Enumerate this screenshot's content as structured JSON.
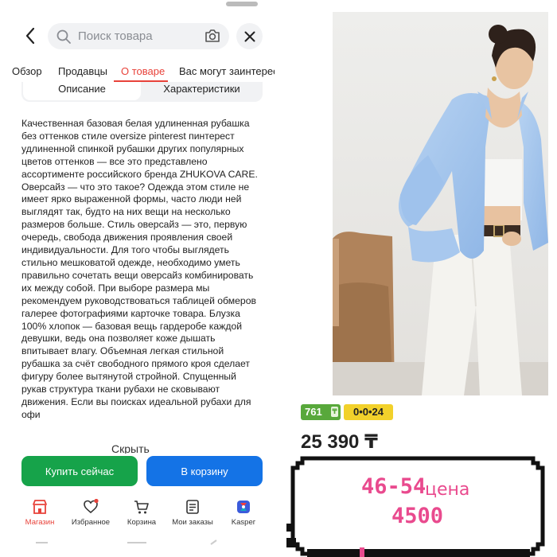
{
  "search": {
    "placeholder": "Поиск товара"
  },
  "tabs": [
    {
      "label": "Обзор"
    },
    {
      "label": "Продавцы"
    },
    {
      "label": "О товаре"
    },
    {
      "label": "Вас могут заинтерес"
    }
  ],
  "active_tab_index": 2,
  "segments": [
    {
      "label": "Описание"
    },
    {
      "label": "Характеристики"
    }
  ],
  "description": "Качественная базовая белая удлиненная рубашка\nбез оттенков стиле oversize pinterest пинтерест\nудлиненной спинкой рубашки других популярных\nцветов оттенков — все это представлено\nассортименте российского бренда ZHUKOVA CARE.\nОверсайз — что это такое? Одежда этом стиле не\nимеет ярко выраженной формы, часто люди ней\nвыглядят так, будто на них вещи на несколько\nразмеров больше. Стиль оверсайз — это, первую\nочередь, свобода движения проявления своей\nиндивидуальности. Для того чтобы выглядеть\nстильно мешковатой одежде, необходимо уметь\nправильно сочетать вещи оверсайз комбинировать\nих между собой. При выборе размера мы\nрекомендуем руководствоваться таблицей обмеров\nгалерее фотографиями карточке товара. Блузка\n100% хлопок — базовая вещь гардеробе каждой\nдевушки, ведь она позволяет коже дышать\nвпитывает влагу. Объемная легкая стильной\nрубашка за счёт свободного прямого кроя сделает\nфигуру более вытянутой стройной. Спущенный\nрукав структура ткани рубахи не сковывают\nдвижения. Если вы поисках идеальной рубахи для\nофи",
  "collapse_label": "Скрыть",
  "buttons": {
    "buy": "Купить сейчас",
    "cart": "В корзину"
  },
  "bottom_nav": [
    {
      "label": "Магазин",
      "icon": "shop-icon"
    },
    {
      "label": "Избранное",
      "icon": "heart-icon"
    },
    {
      "label": "Корзина",
      "icon": "cart-icon"
    },
    {
      "label": "Мои заказы",
      "icon": "orders-icon"
    },
    {
      "label": "Kaspeг",
      "icon": "kaspi-icon"
    }
  ],
  "active_nav_index": 0,
  "product": {
    "installment_badge": "761",
    "installment_badge_suffix": "₸",
    "installment_term": "0•0•24",
    "price": "25 390 ₸"
  },
  "overlay": {
    "size_range": "46-54",
    "price_word": "цена",
    "price_value": "4500"
  },
  "colors": {
    "accent_red": "#e8423a",
    "buy_green": "#16a34a",
    "cart_blue": "#1473e6",
    "badge_green": "#58a83b",
    "badge_yellow": "#f2d12b",
    "overlay_pink": "#e94a8e"
  }
}
